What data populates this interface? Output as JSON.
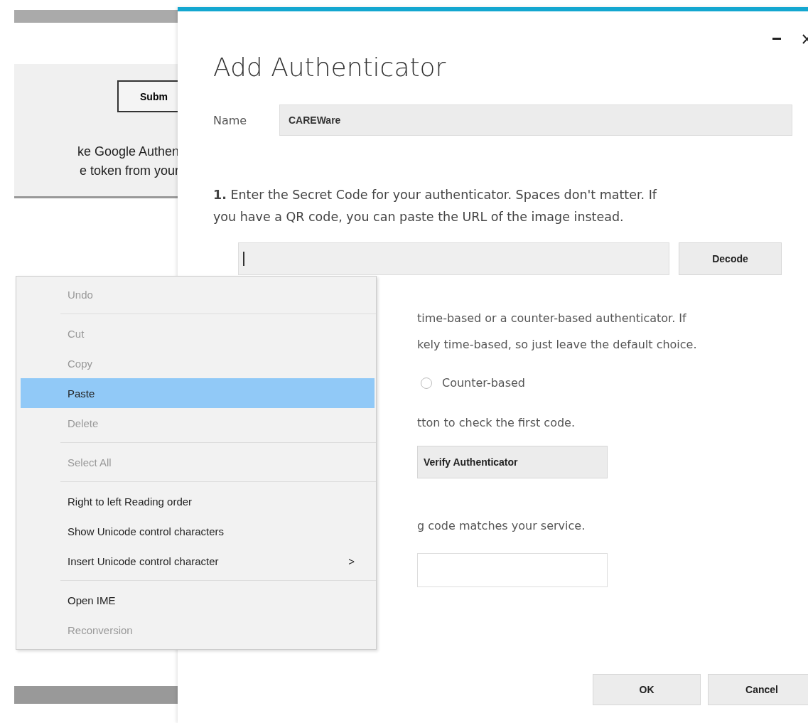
{
  "background_window": {
    "button": "Subm",
    "lines": [
      "ke Google Authen",
      "e token from your"
    ]
  },
  "dialog": {
    "title": "Add Authenticator",
    "name_label": "Name",
    "name_value": "CAREWare",
    "step1": "**1.** Enter the Secret Code for your authenticator. Spaces don't matter. If you have a QR code, you can paste the URL of the image instead.",
    "decode_button": "Decode",
    "step2_lines": [
      "time-based or a counter-based authenticator. If",
      "kely time-based, so just leave the default choice."
    ],
    "radio": {
      "label": "Counter-based",
      "selected": false
    },
    "step3_line": "tton to check the first code.",
    "verify_button": "Verify Authenticator",
    "step4_line": "g code matches your service.",
    "buttons": [
      "OK",
      "Cancel"
    ]
  },
  "context_menu": {
    "groups": [
      [
        {
          "label": "Undo",
          "disabled": true,
          "selected": false
        }
      ],
      [
        {
          "label": "Cut",
          "disabled": true,
          "selected": false
        },
        {
          "label": "Copy",
          "disabled": true,
          "selected": false
        },
        {
          "label": "Paste",
          "disabled": false,
          "selected": true
        },
        {
          "label": "Delete",
          "disabled": true,
          "selected": false
        }
      ],
      [
        {
          "label": "Select All",
          "disabled": true,
          "selected": false
        }
      ],
      [
        {
          "label": "Right to left Reading order",
          "disabled": false,
          "selected": false
        },
        {
          "label": "Show Unicode control characters",
          "disabled": false,
          "selected": false
        },
        {
          "label": "Insert Unicode control character",
          "disabled": false,
          "selected": false,
          "submenu": ">"
        }
      ],
      [
        {
          "label": "Open IME",
          "disabled": false,
          "selected": false
        },
        {
          "label": "Reconversion",
          "disabled": true,
          "selected": false
        }
      ]
    ]
  }
}
